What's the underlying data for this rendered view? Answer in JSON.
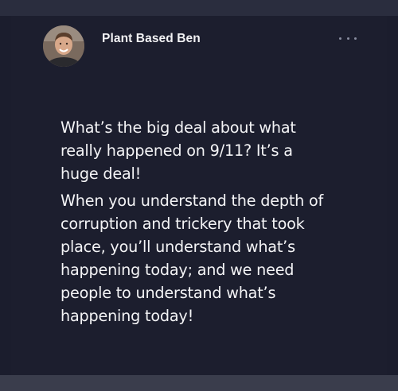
{
  "post": {
    "author": "Plant Based Ben",
    "more_icon": "ellipsis-icon",
    "paragraphs": [
      {
        "lines": [
          "What’s the big deal about what",
          "really happened on 9/11? It’s a",
          "huge deal!"
        ]
      },
      {
        "lines": [
          "When you understand the depth of",
          "corruption and trickery that took",
          "place, you’ll understand what’s",
          "happening today; and we need",
          "people to understand what’s",
          "happening today!"
        ]
      }
    ]
  },
  "colors": {
    "background": "#1b1d2d",
    "text": "#f4f4f6",
    "muted": "#8a8da0"
  }
}
